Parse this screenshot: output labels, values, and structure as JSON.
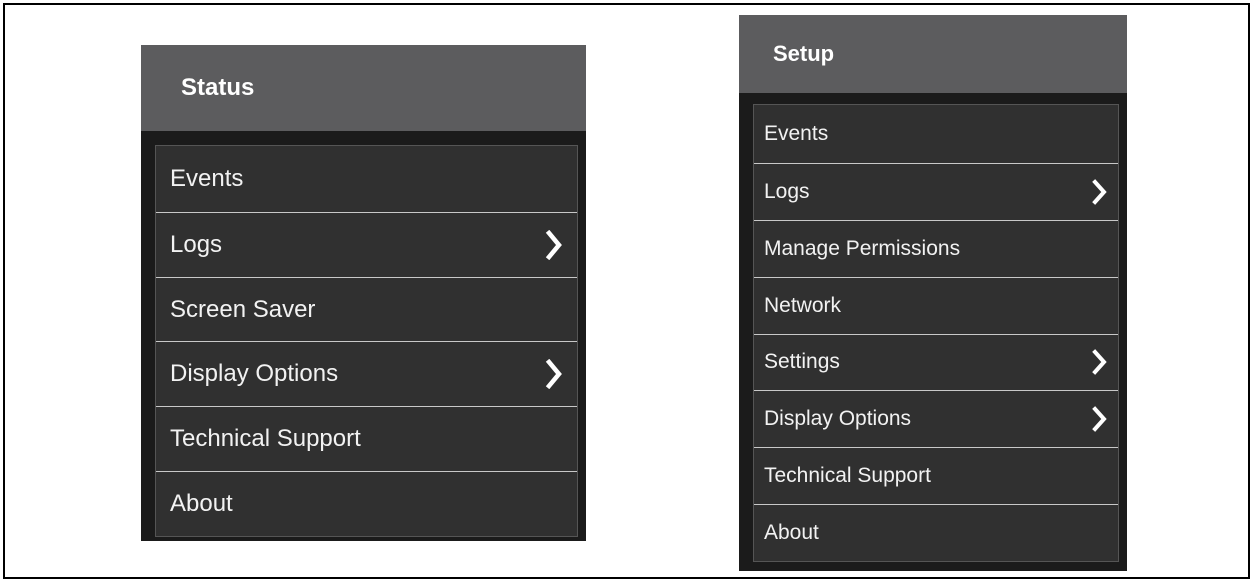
{
  "status_menu": {
    "title": "Status",
    "items": [
      {
        "label": "Events",
        "has_submenu": false
      },
      {
        "label": "Logs",
        "has_submenu": true
      },
      {
        "label": "Screen Saver",
        "has_submenu": false
      },
      {
        "label": "Display Options",
        "has_submenu": true
      },
      {
        "label": "Technical Support",
        "has_submenu": false
      },
      {
        "label": "About",
        "has_submenu": false
      }
    ]
  },
  "setup_menu": {
    "title": "Setup",
    "items": [
      {
        "label": "Events",
        "has_submenu": false
      },
      {
        "label": "Logs",
        "has_submenu": true
      },
      {
        "label": "Manage Permissions",
        "has_submenu": false
      },
      {
        "label": "Network",
        "has_submenu": false
      },
      {
        "label": "Settings",
        "has_submenu": true
      },
      {
        "label": "Display Options",
        "has_submenu": true
      },
      {
        "label": "Technical Support",
        "has_submenu": false
      },
      {
        "label": "About",
        "has_submenu": false
      }
    ]
  },
  "colors": {
    "header_bg": "#5c5c5e",
    "item_bg": "#303030",
    "panel_bg": "#1b1b1b",
    "text": "#f2f2f2",
    "divider": "#c8c8c8"
  },
  "icons": {
    "submenu": "chevron-right-icon"
  }
}
